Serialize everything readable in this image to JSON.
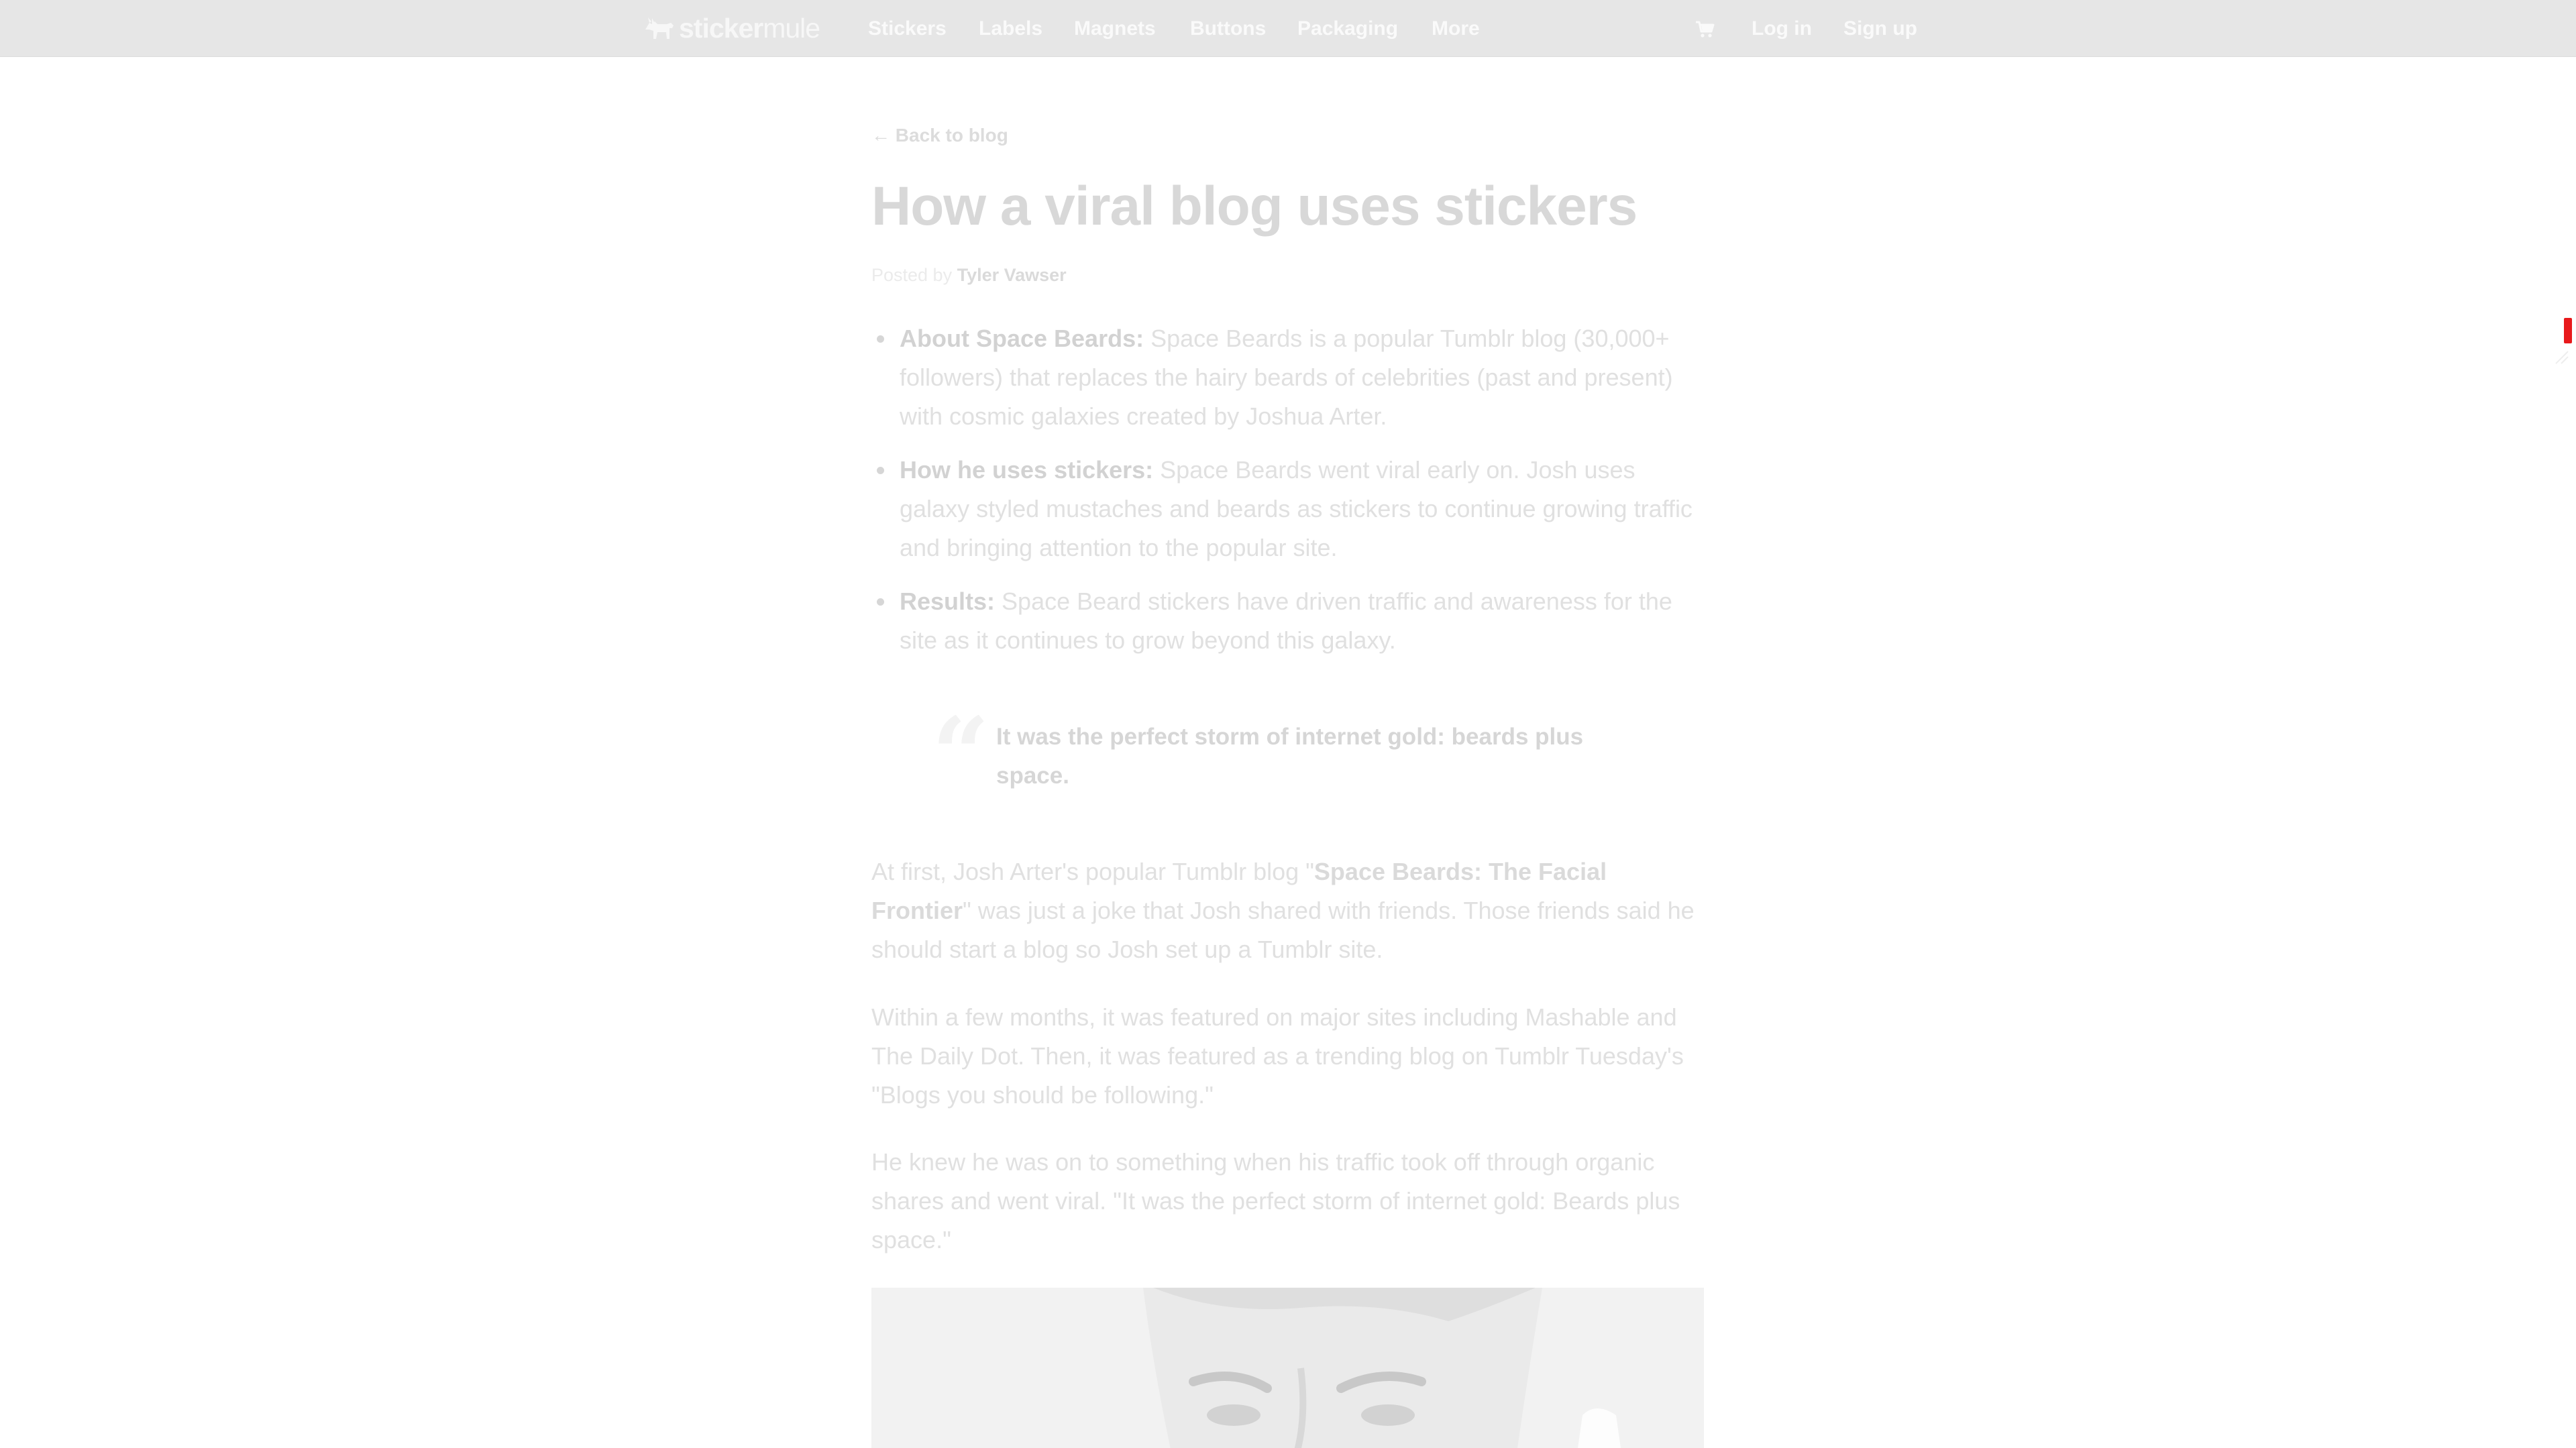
{
  "nav": {
    "logo": {
      "sticker": "sticker",
      "mule": "mule",
      "icon": "mule-logo-icon"
    },
    "links": [
      "Stickers",
      "Labels",
      "Magnets",
      "Buttons",
      "Packaging",
      "More"
    ],
    "cart_icon": "cart-icon",
    "login": "Log in",
    "signup": "Sign up"
  },
  "article": {
    "back_link": "← Back to blog",
    "title": "How a viral blog uses stickers",
    "byline_prefix": "Posted by ",
    "author": "Tyler Vawser",
    "bullets": [
      {
        "lead": "About Space Beards:",
        "text": " Space Beards is a popular Tumblr blog (30,000+ followers) that replaces the hairy beards of celebrities (past and present) with cosmic galaxies created by Joshua Arter."
      },
      {
        "lead": "How he uses stickers:",
        "text": " Space Beards went viral early on. Josh uses galaxy styled mustaches and beards as stickers to continue growing traffic and bringing attention to the popular site."
      },
      {
        "lead": "Results:",
        "text": " Space Beard stickers have driven traffic and awareness for the site as it continues to grow beyond this galaxy."
      }
    ],
    "quote_mark": "“",
    "quote": "It was the perfect storm of internet gold: beards plus space.",
    "paragraph1": {
      "before": "At first, Josh Arter's popular Tumblr blog \"",
      "link": "Space Beards: The Facial Frontier",
      "after": "\" was just a joke that Josh shared with friends. Those friends said he should start a blog so Josh set up a Tumblr site."
    },
    "paragraph2": "Within a few months, it was featured on major sites including Mashable and The Daily Dot. Then, it was featured as a trending blog on Tumblr Tuesday's \"Blogs you should be following.\"",
    "paragraph3": "He knew he was on to something when his traffic took off through organic shares and went viral. \"It was the perfect storm of internet gold: Beards plus space.\""
  },
  "colors": {
    "nav_bg": "#e6e6e6",
    "accent_red": "#e8191b"
  }
}
